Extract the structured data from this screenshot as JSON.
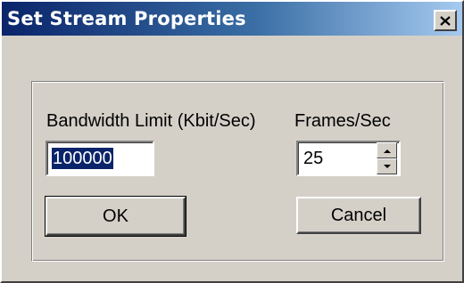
{
  "dialog": {
    "title": "Set Stream Properties"
  },
  "bandwidth": {
    "label": "Bandwidth Limit (Kbit/Sec)",
    "value": "100000"
  },
  "fps": {
    "label": "Frames/Sec",
    "value": "25"
  },
  "buttons": {
    "ok_label": "OK",
    "cancel_label": "Cancel"
  },
  "icons": {
    "close": "close-icon",
    "spin_up": "arrow-up-icon",
    "spin_down": "arrow-down-icon"
  },
  "colors": {
    "title_gradient_start": "#0a246a",
    "title_gradient_end": "#a6caf0",
    "dialog_face": "#d4d0c8",
    "selection": "#0a246a"
  }
}
